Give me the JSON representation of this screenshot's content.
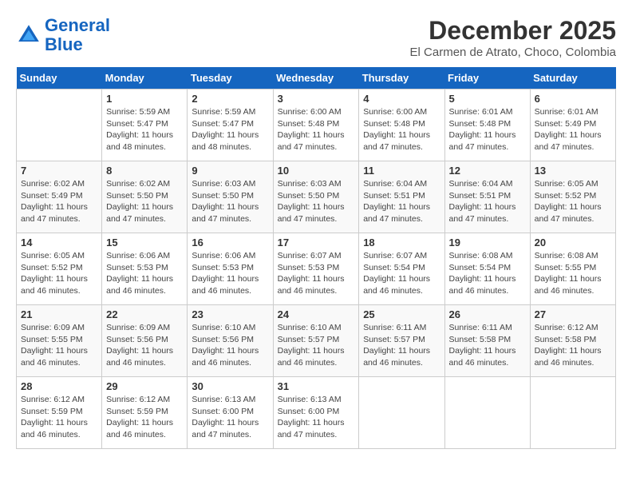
{
  "header": {
    "logo_line1": "General",
    "logo_line2": "Blue",
    "month_title": "December 2025",
    "location": "El Carmen de Atrato, Choco, Colombia"
  },
  "weekdays": [
    "Sunday",
    "Monday",
    "Tuesday",
    "Wednesday",
    "Thursday",
    "Friday",
    "Saturday"
  ],
  "weeks": [
    [
      {
        "day": "",
        "info": ""
      },
      {
        "day": "1",
        "info": "Sunrise: 5:59 AM\nSunset: 5:47 PM\nDaylight: 11 hours\nand 48 minutes."
      },
      {
        "day": "2",
        "info": "Sunrise: 5:59 AM\nSunset: 5:47 PM\nDaylight: 11 hours\nand 48 minutes."
      },
      {
        "day": "3",
        "info": "Sunrise: 6:00 AM\nSunset: 5:48 PM\nDaylight: 11 hours\nand 47 minutes."
      },
      {
        "day": "4",
        "info": "Sunrise: 6:00 AM\nSunset: 5:48 PM\nDaylight: 11 hours\nand 47 minutes."
      },
      {
        "day": "5",
        "info": "Sunrise: 6:01 AM\nSunset: 5:48 PM\nDaylight: 11 hours\nand 47 minutes."
      },
      {
        "day": "6",
        "info": "Sunrise: 6:01 AM\nSunset: 5:49 PM\nDaylight: 11 hours\nand 47 minutes."
      }
    ],
    [
      {
        "day": "7",
        "info": "Sunrise: 6:02 AM\nSunset: 5:49 PM\nDaylight: 11 hours\nand 47 minutes."
      },
      {
        "day": "8",
        "info": "Sunrise: 6:02 AM\nSunset: 5:50 PM\nDaylight: 11 hours\nand 47 minutes."
      },
      {
        "day": "9",
        "info": "Sunrise: 6:03 AM\nSunset: 5:50 PM\nDaylight: 11 hours\nand 47 minutes."
      },
      {
        "day": "10",
        "info": "Sunrise: 6:03 AM\nSunset: 5:50 PM\nDaylight: 11 hours\nand 47 minutes."
      },
      {
        "day": "11",
        "info": "Sunrise: 6:04 AM\nSunset: 5:51 PM\nDaylight: 11 hours\nand 47 minutes."
      },
      {
        "day": "12",
        "info": "Sunrise: 6:04 AM\nSunset: 5:51 PM\nDaylight: 11 hours\nand 47 minutes."
      },
      {
        "day": "13",
        "info": "Sunrise: 6:05 AM\nSunset: 5:52 PM\nDaylight: 11 hours\nand 47 minutes."
      }
    ],
    [
      {
        "day": "14",
        "info": "Sunrise: 6:05 AM\nSunset: 5:52 PM\nDaylight: 11 hours\nand 46 minutes."
      },
      {
        "day": "15",
        "info": "Sunrise: 6:06 AM\nSunset: 5:53 PM\nDaylight: 11 hours\nand 46 minutes."
      },
      {
        "day": "16",
        "info": "Sunrise: 6:06 AM\nSunset: 5:53 PM\nDaylight: 11 hours\nand 46 minutes."
      },
      {
        "day": "17",
        "info": "Sunrise: 6:07 AM\nSunset: 5:53 PM\nDaylight: 11 hours\nand 46 minutes."
      },
      {
        "day": "18",
        "info": "Sunrise: 6:07 AM\nSunset: 5:54 PM\nDaylight: 11 hours\nand 46 minutes."
      },
      {
        "day": "19",
        "info": "Sunrise: 6:08 AM\nSunset: 5:54 PM\nDaylight: 11 hours\nand 46 minutes."
      },
      {
        "day": "20",
        "info": "Sunrise: 6:08 AM\nSunset: 5:55 PM\nDaylight: 11 hours\nand 46 minutes."
      }
    ],
    [
      {
        "day": "21",
        "info": "Sunrise: 6:09 AM\nSunset: 5:55 PM\nDaylight: 11 hours\nand 46 minutes."
      },
      {
        "day": "22",
        "info": "Sunrise: 6:09 AM\nSunset: 5:56 PM\nDaylight: 11 hours\nand 46 minutes."
      },
      {
        "day": "23",
        "info": "Sunrise: 6:10 AM\nSunset: 5:56 PM\nDaylight: 11 hours\nand 46 minutes."
      },
      {
        "day": "24",
        "info": "Sunrise: 6:10 AM\nSunset: 5:57 PM\nDaylight: 11 hours\nand 46 minutes."
      },
      {
        "day": "25",
        "info": "Sunrise: 6:11 AM\nSunset: 5:57 PM\nDaylight: 11 hours\nand 46 minutes."
      },
      {
        "day": "26",
        "info": "Sunrise: 6:11 AM\nSunset: 5:58 PM\nDaylight: 11 hours\nand 46 minutes."
      },
      {
        "day": "27",
        "info": "Sunrise: 6:12 AM\nSunset: 5:58 PM\nDaylight: 11 hours\nand 46 minutes."
      }
    ],
    [
      {
        "day": "28",
        "info": "Sunrise: 6:12 AM\nSunset: 5:59 PM\nDaylight: 11 hours\nand 46 minutes."
      },
      {
        "day": "29",
        "info": "Sunrise: 6:12 AM\nSunset: 5:59 PM\nDaylight: 11 hours\nand 46 minutes."
      },
      {
        "day": "30",
        "info": "Sunrise: 6:13 AM\nSunset: 6:00 PM\nDaylight: 11 hours\nand 47 minutes."
      },
      {
        "day": "31",
        "info": "Sunrise: 6:13 AM\nSunset: 6:00 PM\nDaylight: 11 hours\nand 47 minutes."
      },
      {
        "day": "",
        "info": ""
      },
      {
        "day": "",
        "info": ""
      },
      {
        "day": "",
        "info": ""
      }
    ]
  ]
}
